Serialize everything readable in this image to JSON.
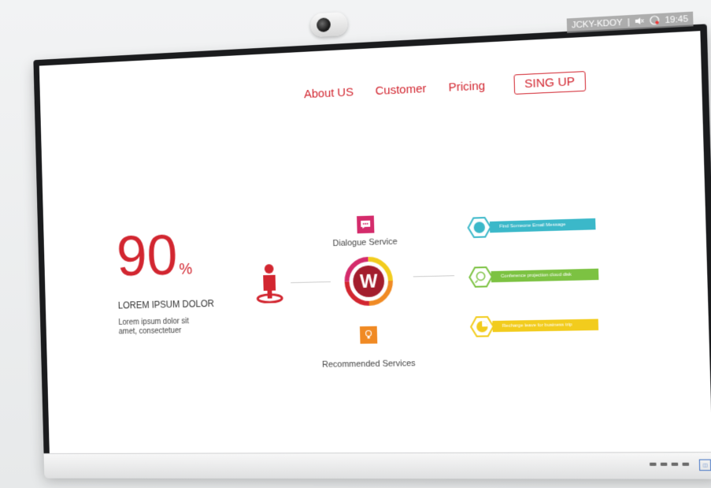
{
  "status": {
    "device_name": "JCKY-KDOY",
    "separator": "|",
    "time": "19:45"
  },
  "nav": {
    "about": "About US",
    "customer": "Customer",
    "pricing": "Pricing",
    "signup": "SING UP"
  },
  "stat": {
    "number": "90",
    "unit": "%",
    "heading": "LOREM IPSUM DOLOR",
    "body": "Lorem ipsum dolor sit amet, consectetuer"
  },
  "services": {
    "dialogue": "Dialogue Service",
    "recommended": "Recommended Services",
    "logo_letter": "W"
  },
  "features": [
    {
      "label": "Find Someone Email Message",
      "color": "#3bb8c9",
      "icon": "person-icon"
    },
    {
      "label": "Conference projection cloud disk",
      "color": "#7cc242",
      "icon": "search-icon"
    },
    {
      "label": "Recharge leave for business trip",
      "color": "#f2cc1d",
      "icon": "pie-chart-icon"
    }
  ],
  "colors": {
    "accent": "#d22630"
  }
}
